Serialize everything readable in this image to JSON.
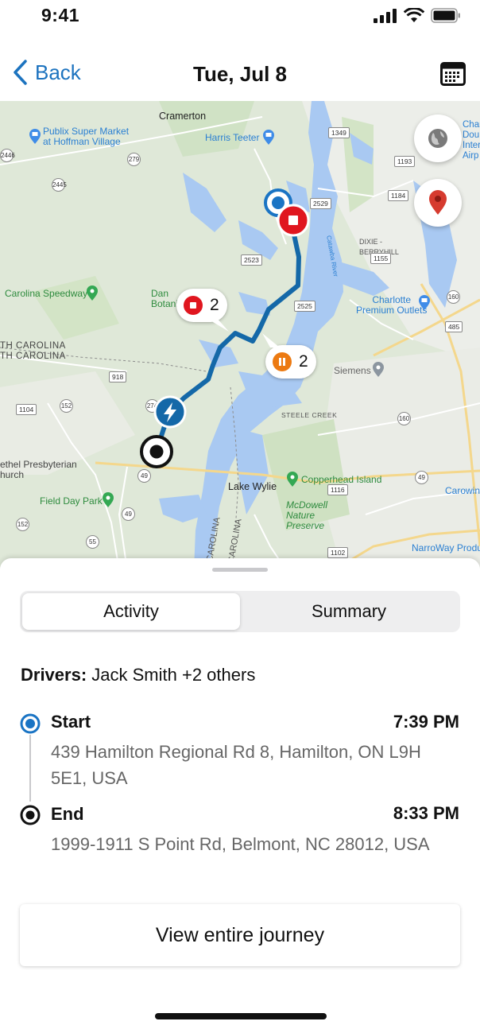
{
  "status_bar": {
    "time": "9:41"
  },
  "nav": {
    "back_label": "Back",
    "title": "Tue, Jul 8"
  },
  "map": {
    "labels": {
      "cramerton": "Cramerton",
      "publix": "Publix Super Market\nat Hoffman Village",
      "harris_teeter": "Harris Teeter",
      "char_dou": "Char\nDou\nIntern\nAirp",
      "dixie_berryhill": "DIXIE -\nBERRYHILL",
      "carolina_speedway": "Carolina Speedway",
      "botanic": "Dan\nBotani",
      "charlotte_outlets": "Charlotte\nPremium Outlets",
      "north_carolina": "TH CAROLINA\nTH CAROLINA",
      "siemens": "Siemens",
      "steele_creek": "STEELE CREEK",
      "bethel": "ethel Presbyterian\nhurch",
      "lake_wylie": "Lake Wylie",
      "copperhead": "Copperhead Island",
      "field_day": "Field Day Park",
      "mcdowell": "McDowell\nNature\nPreserve",
      "carowinds": "Carowin",
      "narroway": "NarroWay Produ",
      "carolina_river_1": "CAROLINA",
      "carolina_river_2": "CAROLINA",
      "catawba": "Catawba River"
    },
    "shields": [
      "1349",
      "1193",
      "1184",
      "2529",
      "2523",
      "1155",
      "2525",
      "2446",
      "2445",
      "279",
      "918",
      "1104",
      "152",
      "274",
      "49",
      "55",
      "49",
      "160",
      "160",
      "49",
      "1116",
      "1102",
      "485",
      "152"
    ],
    "stop_bubble_count": "2",
    "pause_bubble_count": "2",
    "colors": {
      "route": "#1468a8",
      "stop": "#e0161f",
      "pause": "#ec7a12",
      "water": "#a9c9f2",
      "land": "#dfe8d8"
    }
  },
  "tabs": {
    "activity": "Activity",
    "summary": "Summary",
    "selected": "Activity"
  },
  "drivers": {
    "label": "Drivers:",
    "value": "Jack Smith +2 others"
  },
  "start": {
    "label": "Start",
    "time": "7:39 PM",
    "address": "439 Hamilton Regional Rd 8, Hamilton, ON L9H 5E1, USA"
  },
  "end": {
    "label": "End",
    "time": "8:33 PM",
    "address": "1999-1911 S Point Rd, Belmont, NC 28012, USA"
  },
  "journey_button": "View entire journey",
  "icons": {
    "back": "chevron-left-icon",
    "calendar": "calendar-icon",
    "globe": "globe-icon",
    "pin": "map-pin-icon",
    "start": "start-marker-icon",
    "end": "end-marker-icon",
    "stop": "stop-icon",
    "pause": "pause-icon",
    "charge": "lightning-icon"
  }
}
